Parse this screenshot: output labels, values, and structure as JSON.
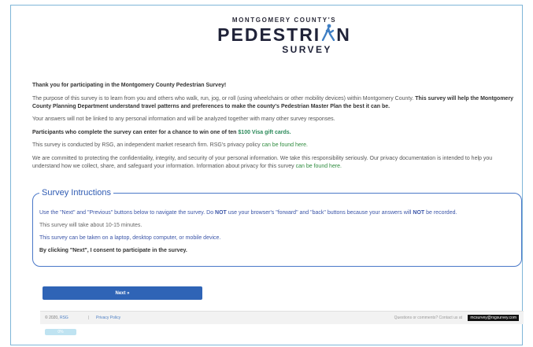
{
  "logo": {
    "line1": "MONTGOMERY COUNTY'S",
    "line2_a": "PEDESTRI",
    "line2_icon": "walking-person-icon",
    "line2_b": "N",
    "line3": "SURVEY"
  },
  "intro": {
    "thanks": "Thank you for participating in the Montgomery County Pedestrian Survey!",
    "purpose_a": "The purpose of this survey is to learn from you and others who walk, run, jog, or roll (using wheelchairs or other mobility devices) within Montgomery County.",
    "purpose_b": " This survey will help the Montgomery County Planning Department understand travel patterns and preferences to make the county's ",
    "purpose_link": "Pedestrian Master Plan",
    "purpose_c": " the best it can be.",
    "anonymity": "Your answers will not be linked to any personal information and will be analyzed together with many other survey responses.",
    "incentive_a": "Participants who complete the survey can enter for a chance to win one of ten ",
    "incentive_link": "$100 Visa gift cards.",
    "rsg_a": "This survey is conducted by RSG, an independent market research firm. RSG's privacy policy ",
    "rsg_link": "can be found here.",
    "privacy_a": "We are committed to protecting the confidentiality, integrity, and security of your personal information. We take this responsibility seriously. Our privacy documentation is intended to help you understand how we collect, share, and safeguard your information. Information about privacy for this survey ",
    "privacy_link": "can be found here."
  },
  "instructions": {
    "title": "Survey Intructions",
    "nav_a": "Use the \"Next\" and \"Previous\" buttons below to navigate the survey. Do ",
    "nav_not1": "NOT",
    "nav_b": " use your browser's \"forward\" and \"back\" buttons because your answers will ",
    "nav_not2": "NOT",
    "nav_c": " be recorded.",
    "duration": "This survey will take about 10-15 minutes.",
    "devices": "This survey can be taken on a laptop, desktop computer, or mobile device.",
    "consent": "By clicking \"Next\", I consent to participate in the survey."
  },
  "next_label": "Next »",
  "footer": {
    "copyright_prefix": "© 2020, ",
    "copyright_link": "RSG",
    "separator": "|",
    "privacy": "Privacy Policy",
    "questions": "Questions or comments? Contact us at",
    "email": "mcsurvey@rsgsurvey.com"
  },
  "progress": {
    "value": 0,
    "label": "0%"
  }
}
